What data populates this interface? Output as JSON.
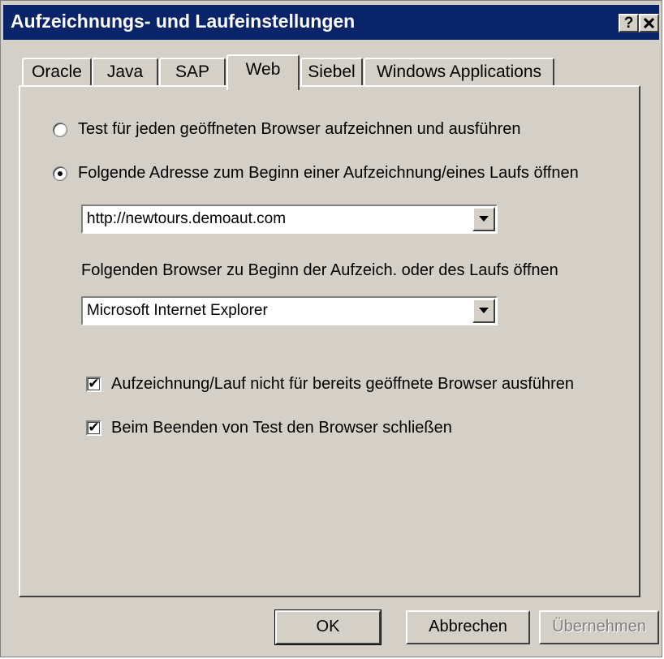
{
  "window": {
    "title": "Aufzeichnungs- und Laufeinstellungen",
    "help_label": "?",
    "close_label": "✕"
  },
  "tabs": [
    {
      "label": "Oracle",
      "active": false
    },
    {
      "label": "Java",
      "active": false
    },
    {
      "label": "SAP",
      "active": false
    },
    {
      "label": "Web",
      "active": true
    },
    {
      "label": "Siebel",
      "active": false
    },
    {
      "label": "Windows Applications",
      "active": false
    }
  ],
  "web": {
    "radio_any_browser": "Test für jeden geöffneten Browser aufzeichnen und ausführen",
    "radio_open_address": "Folgende Adresse zum Beginn einer Aufzeichnung/eines Laufs öffnen",
    "address_value": "http://newtours.demoaut.com",
    "browser_label": "Folgenden Browser zu Beginn der Aufzeich. oder des Laufs öffnen",
    "browser_value": "Microsoft Internet Explorer",
    "check_no_open_browsers": "Aufzeichnung/Lauf nicht für bereits geöffnete Browser ausführen",
    "check_close_browser": "Beim Beenden von Test den Browser schließen",
    "check_mark": "✔"
  },
  "buttons": {
    "ok": "OK",
    "cancel": "Abbrechen",
    "apply": "Übernehmen"
  }
}
